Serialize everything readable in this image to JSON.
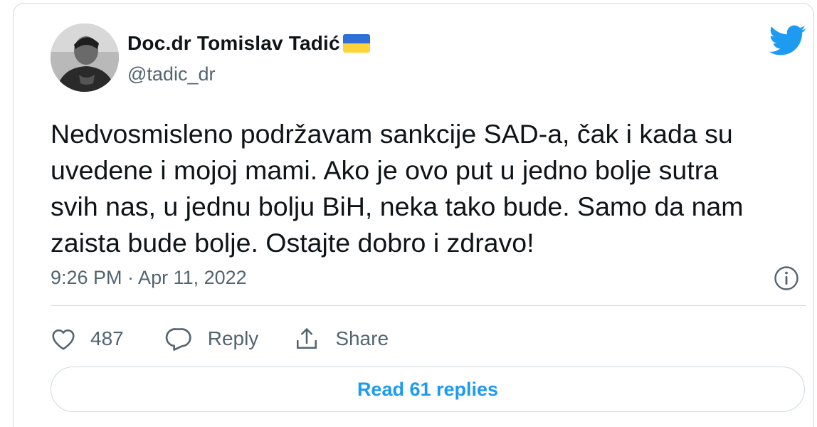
{
  "author": {
    "display_name": "Doc.dr Tomislav Tadić",
    "handle": "@tadic_dr",
    "flag_icon": "ukraine-flag-icon"
  },
  "brand": {
    "logo_icon": "twitter-bird-icon",
    "accent_color": "#1d9bf0"
  },
  "tweet": {
    "lines": [
      "Nedvosmisleno podržavam sankcije SAD-a, čak i kada su",
      "uvedene i mojoj mami. Ako je ovo put u jedno bolje sutra",
      "svih nas, u jednu bolju BiH, neka tako bude. Samo da nam",
      "zaista bude bolje. Ostajte dobro i zdravo!"
    ],
    "timestamp": "9:26 PM · Apr 11, 2022",
    "info_icon": "info-icon"
  },
  "actions": {
    "like_count": "487",
    "like_icon": "heart-icon",
    "reply_label": "Reply",
    "reply_icon": "speech-bubble-icon",
    "share_label": "Share",
    "share_icon": "share-icon"
  },
  "read_replies_label": "Read 61 replies",
  "colors": {
    "text_primary": "#0f1419",
    "text_secondary": "#536471",
    "border": "#cfd9de"
  }
}
